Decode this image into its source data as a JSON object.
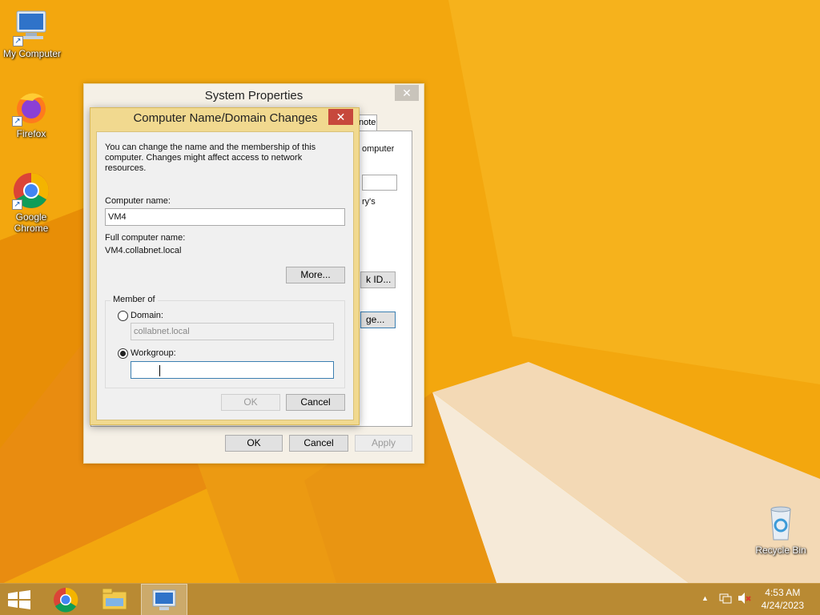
{
  "desktop": {
    "icons": [
      {
        "label": "My Computer"
      },
      {
        "label": "Firefox"
      },
      {
        "label": "Google Chrome"
      },
      {
        "label": "Recycle Bin"
      }
    ]
  },
  "system_properties": {
    "title": "System Properties",
    "tab_remote_label": "note",
    "bg_text_computer": "omputer",
    "bg_text_ys": "ry's",
    "network_id_button": "k ID...",
    "change_button": "ge...",
    "ok_button": "OK",
    "cancel_button": "Cancel",
    "apply_button": "Apply"
  },
  "dialog": {
    "title": "Computer Name/Domain Changes",
    "description": "You can change the name and the membership of this computer. Changes might affect access to network resources.",
    "computer_name_label": "Computer name:",
    "computer_name_value": "VM4",
    "full_name_label": "Full computer name:",
    "full_name_value": "VM4.collabnet.local",
    "more_button": "More...",
    "member_of_label": "Member of",
    "domain_label": "Domain:",
    "domain_value": "collabnet.local",
    "workgroup_label": "Workgroup:",
    "workgroup_value": "",
    "selected_membership": "workgroup",
    "ok_button": "OK",
    "cancel_button": "Cancel"
  },
  "taskbar": {
    "items": [
      "start-icon",
      "chrome-icon",
      "file-explorer-icon",
      "system-properties-icon"
    ],
    "active_item": "system-properties-icon",
    "clock_time": "4:53 AM",
    "clock_date": "4/24/2023"
  },
  "colors": {
    "wallpaper": "#f3a70e",
    "dialog_frame": "#f1d98f",
    "close_button": "#c7483c",
    "taskbar": "#b98a33"
  }
}
